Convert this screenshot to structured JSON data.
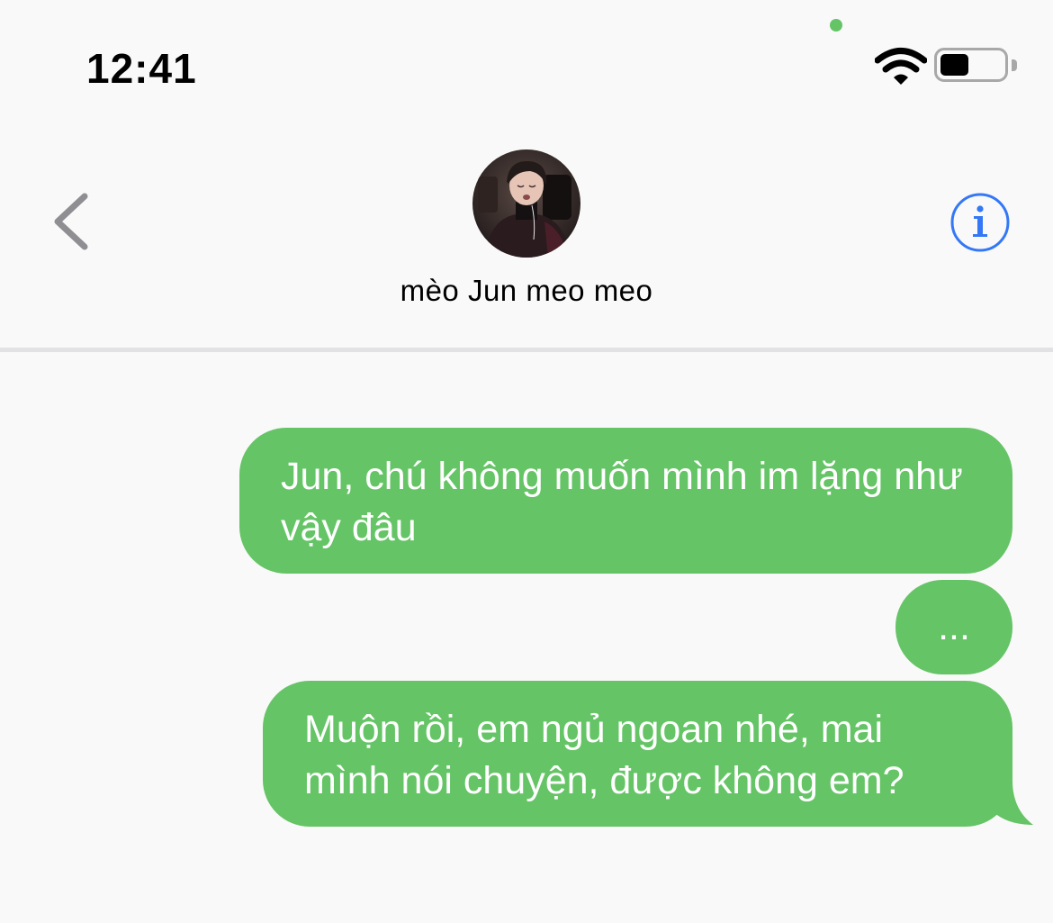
{
  "status_bar": {
    "time": "12:41",
    "icons": [
      "mic-in-use-dot",
      "wifi-icon",
      "battery-icon"
    ],
    "battery_level_fraction": 0.4
  },
  "header": {
    "back_icon": "chevron-left-icon",
    "contact_name": "mèo Jun meo meo",
    "info_icon": "info-icon"
  },
  "messages": [
    {
      "direction": "outgoing",
      "text": "Jun, chú không muốn mình im lặng như vậy đâu"
    },
    {
      "direction": "outgoing",
      "text": "..."
    },
    {
      "direction": "outgoing",
      "text": "Muộn rồi, em ngủ ngoan nhé, mai mình nói chuyện, được không em?"
    }
  ],
  "colors": {
    "background": "#f9f9f9",
    "bubble_outgoing": "#65c466",
    "bubble_text": "#ffffff",
    "accent": "#3478f6",
    "back_chevron": "#8e8e93"
  }
}
